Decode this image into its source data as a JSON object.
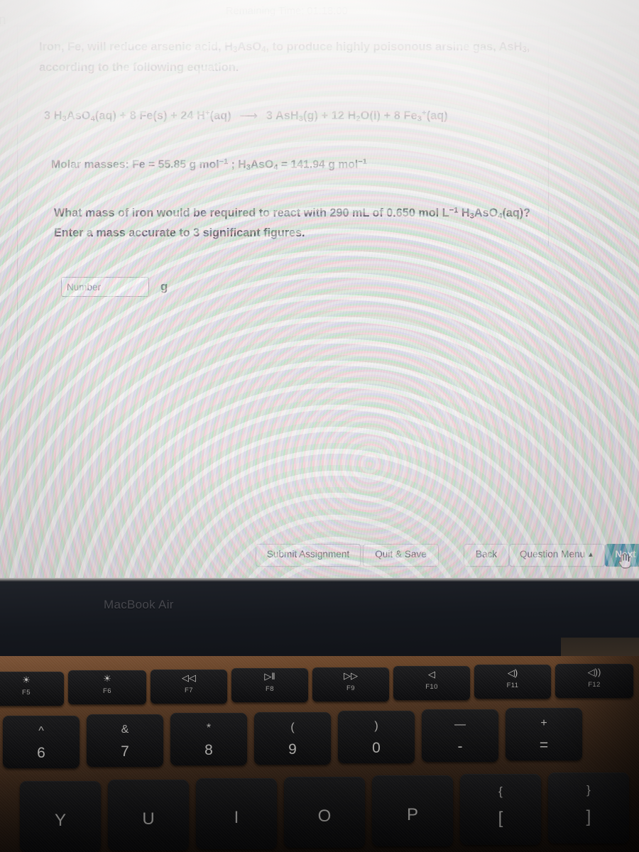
{
  "screen": {
    "edge_char": "n",
    "timer": {
      "label": "Remaining Time:",
      "value": "01:18:00",
      "full": "Remaining Time:  01:18:00"
    },
    "question": {
      "intro_line1_a": "Iron, Fe, will reduce arsenic acid, H",
      "intro_line1_b": "3",
      "intro_line1_c": "AsO",
      "intro_line1_d": "4",
      "intro_line1_e": ", to produce highly poisonous arsine gas, AsH",
      "intro_line1_f": "3",
      "intro_line1_g": ",",
      "intro_line2": "according to the following equation.",
      "equation_plain": "3 H3AsO4(aq) + 8 Fe(s) + 24 H+(aq) ⟶ 3 AsH3(g) + 12 H2O(l) + 8 Fe3+(aq)",
      "molar_masses_plain": "Molar masses:  Fe = 55.85 g mol-1 ; H3AsO4 = 141.94 g mol-1",
      "prompt_plain": "What mass of iron would be required to react with 290 mL of 0.650 mol L-1 H3AsO4(aq)?",
      "prompt_line2": "Enter a mass accurate to 3 significant figures.",
      "molar_mass_Fe": "55.85",
      "molar_mass_H3AsO4": "141.94",
      "volume_mL": "290",
      "concentration_mol_per_L": "0.650",
      "sig_figs": "3"
    },
    "answer": {
      "input_placeholder": "Number",
      "input_value": "",
      "unit": "g"
    },
    "buttons": {
      "submit": "Submit Assignment",
      "quit": "Quit & Save",
      "back": "Back",
      "menu": "Question Menu",
      "menu_caret": "▲",
      "next": "Next"
    },
    "accent_color": "#1a7f9c"
  },
  "laptop": {
    "model_label": "MacBook Air",
    "function_keys": [
      {
        "label": "F5",
        "glyph": "☀"
      },
      {
        "label": "F6",
        "glyph": "☀"
      },
      {
        "label": "F7",
        "glyph": "◁◁"
      },
      {
        "label": "F8",
        "glyph": "▷‖"
      },
      {
        "label": "F9",
        "glyph": "▷▷"
      },
      {
        "label": "F10",
        "glyph": "◁"
      },
      {
        "label": "F11",
        "glyph": "◁)"
      },
      {
        "label": "F12",
        "glyph": "◁))"
      }
    ],
    "number_row": [
      {
        "upper": "^",
        "lower": "6"
      },
      {
        "upper": "&",
        "lower": "7"
      },
      {
        "upper": "*",
        "lower": "8"
      },
      {
        "upper": "(",
        "lower": "9"
      },
      {
        "upper": ")",
        "lower": "0"
      },
      {
        "upper": "—",
        "lower": "-"
      },
      {
        "upper": "+",
        "lower": "="
      }
    ],
    "letter_row": [
      {
        "upper": "",
        "lower": "Y"
      },
      {
        "upper": "",
        "lower": "U"
      },
      {
        "upper": "",
        "lower": "I"
      },
      {
        "upper": "",
        "lower": "O"
      },
      {
        "upper": "",
        "lower": "P"
      },
      {
        "upper": "{",
        "lower": "["
      },
      {
        "upper": "}",
        "lower": "]"
      }
    ]
  }
}
